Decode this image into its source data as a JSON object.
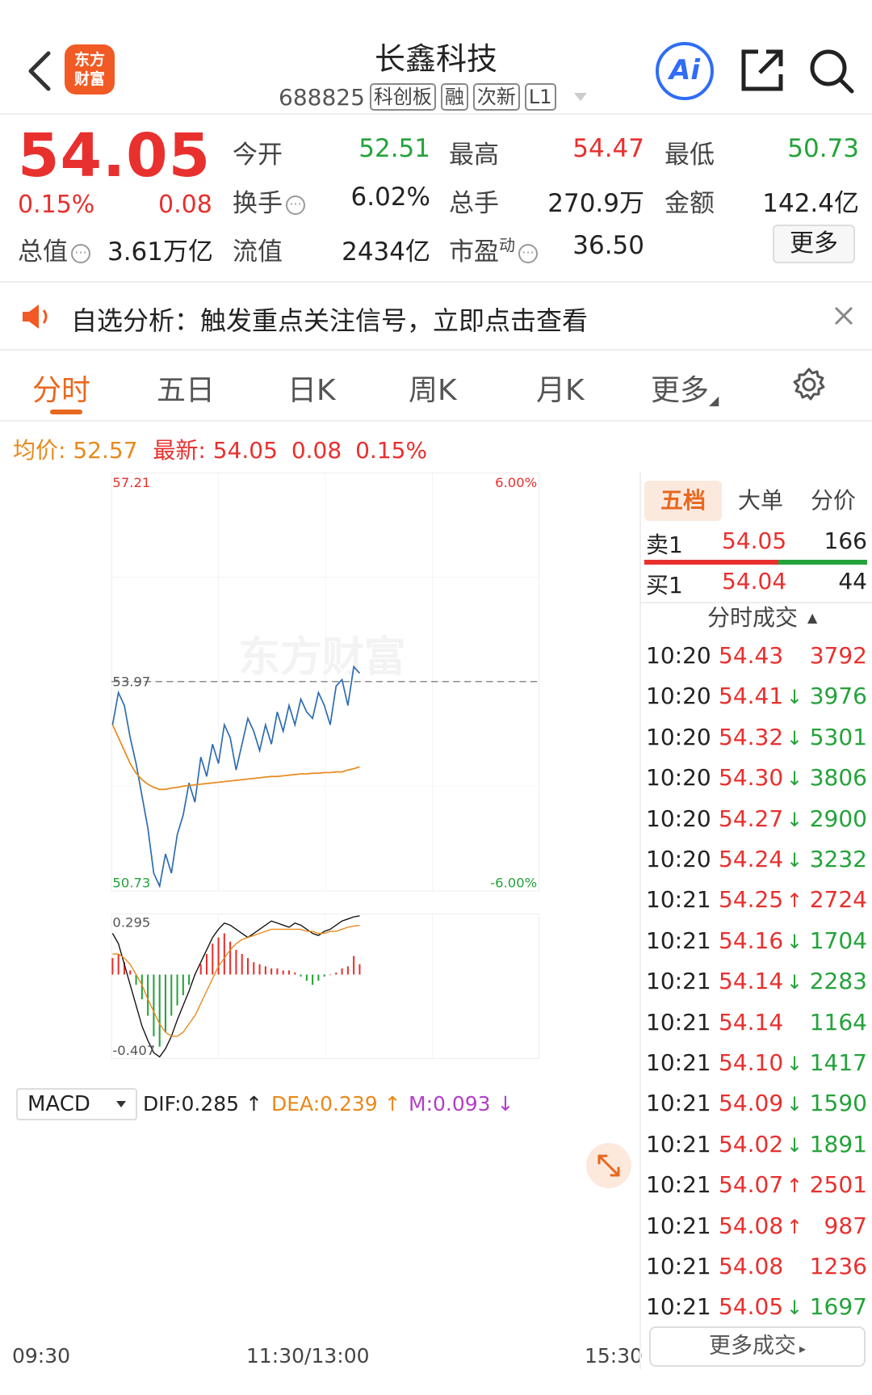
{
  "header": {
    "logo_text": "东方\n财富",
    "title": "长鑫科技",
    "code": "688825",
    "tags": [
      "科创板",
      "融",
      "次新",
      "L1"
    ],
    "ai_label": "Ai"
  },
  "quote": {
    "price": "54.05",
    "change_pct": "0.15%",
    "change": "0.08",
    "stats": [
      {
        "label": "今开",
        "value": "52.51",
        "color": "green"
      },
      {
        "label": "最高",
        "value": "54.47",
        "color": "red"
      },
      {
        "label": "最低",
        "value": "50.73",
        "color": "green"
      },
      {
        "label": "换手",
        "value": "6.02%",
        "color": "black"
      },
      {
        "label": "总手",
        "value": "270.9万",
        "color": "black"
      },
      {
        "label": "金额",
        "value": "142.4亿",
        "color": "black"
      },
      {
        "label": "总值",
        "value": "3.61万亿",
        "color": "black"
      },
      {
        "label": "流值",
        "value": "2434亿",
        "color": "black"
      },
      {
        "label": "市盈",
        "label_sup": "动",
        "value": "36.50",
        "color": "black"
      }
    ],
    "more_label": "更多"
  },
  "notice": {
    "text": "自选分析：触发重点关注信号，立即点击查看"
  },
  "tabs": [
    {
      "label": "分时",
      "active": true
    },
    {
      "label": "五日",
      "active": false
    },
    {
      "label": "日K",
      "active": false
    },
    {
      "label": "周K",
      "active": false
    },
    {
      "label": "月K",
      "active": false
    },
    {
      "label": "更多",
      "active": false
    }
  ],
  "avg_line": {
    "avg_label": "均价:",
    "avg_value": "52.57",
    "latest_label": "最新:",
    "latest_value": "54.05",
    "latest_change": "0.08",
    "latest_pct": "0.15%"
  },
  "chart_data": {
    "type": "line",
    "title": "",
    "y_top_label": "57.21",
    "y_bottom_label": "50.73",
    "y_mid_label": "53.97",
    "pct_top_label": "6.00%",
    "pct_bottom_label": "-6.00%",
    "ylim": [
      50.73,
      57.21
    ],
    "prev_close": 53.97,
    "x_labels": [
      "09:30",
      "11:30/13:00",
      "15:30"
    ],
    "minutes_total": 240,
    "price_series": [
      53.3,
      53.8,
      53.6,
      53.1,
      52.7,
      52.2,
      51.7,
      51.0,
      50.8,
      51.3,
      51.0,
      51.6,
      51.9,
      52.4,
      52.1,
      52.8,
      52.5,
      53.0,
      52.7,
      53.3,
      53.1,
      52.6,
      53.0,
      53.4,
      53.2,
      52.9,
      53.3,
      53.0,
      53.5,
      53.2,
      53.6,
      53.3,
      53.7,
      53.5,
      53.4,
      53.8,
      53.6,
      53.3,
      53.9,
      54.0,
      53.6,
      54.2,
      54.1
    ],
    "avg_series": [
      53.3,
      53.1,
      52.9,
      52.7,
      52.55,
      52.45,
      52.38,
      52.33,
      52.3,
      52.3,
      52.32,
      52.33,
      52.35,
      52.36,
      52.37,
      52.38,
      52.39,
      52.4,
      52.41,
      52.42,
      52.43,
      52.44,
      52.45,
      52.46,
      52.47,
      52.48,
      52.49,
      52.5,
      52.5,
      52.51,
      52.52,
      52.53,
      52.54,
      52.54,
      52.55,
      52.55,
      52.56,
      52.56,
      52.57,
      52.57,
      52.6,
      52.62,
      52.65
    ],
    "macd": {
      "name": "MACD",
      "dif_label": "DIF:0.285 ↑",
      "dea_label": "DEA:0.239 ↑",
      "m_label": "M:0.093 ↓",
      "y_top_label": "0.295",
      "y_bottom_label": "-0.407",
      "ylim": [
        -0.407,
        0.295
      ],
      "hist": [
        0.08,
        0.1,
        0.06,
        0.02,
        -0.05,
        -0.12,
        -0.2,
        -0.3,
        -0.35,
        -0.28,
        -0.2,
        -0.15,
        -0.1,
        -0.05,
        0.0,
        0.05,
        0.1,
        0.15,
        0.18,
        0.2,
        0.16,
        0.12,
        0.1,
        0.08,
        0.06,
        0.05,
        0.04,
        0.03,
        0.03,
        0.02,
        0.02,
        0.01,
        -0.01,
        -0.03,
        -0.05,
        -0.03,
        -0.01,
        0.0,
        0.01,
        0.03,
        0.04,
        0.09,
        0.05
      ],
      "dif": [
        0.2,
        0.15,
        0.05,
        -0.05,
        -0.15,
        -0.25,
        -0.32,
        -0.38,
        -0.4,
        -0.36,
        -0.3,
        -0.22,
        -0.15,
        -0.08,
        0.0,
        0.06,
        0.12,
        0.18,
        0.22,
        0.25,
        0.24,
        0.22,
        0.2,
        0.18,
        0.2,
        0.22,
        0.24,
        0.26,
        0.25,
        0.24,
        0.23,
        0.25,
        0.24,
        0.22,
        0.2,
        0.19,
        0.21,
        0.22,
        0.24,
        0.26,
        0.27,
        0.28,
        0.285
      ],
      "dea": [
        0.1,
        0.1,
        0.08,
        0.05,
        0.0,
        -0.05,
        -0.12,
        -0.18,
        -0.24,
        -0.28,
        -0.3,
        -0.3,
        -0.28,
        -0.24,
        -0.2,
        -0.14,
        -0.08,
        -0.02,
        0.04,
        0.08,
        0.12,
        0.15,
        0.17,
        0.18,
        0.19,
        0.2,
        0.21,
        0.22,
        0.22,
        0.22,
        0.22,
        0.22,
        0.22,
        0.21,
        0.21,
        0.2,
        0.2,
        0.21,
        0.21,
        0.22,
        0.23,
        0.235,
        0.239
      ]
    }
  },
  "side": {
    "tabs": [
      "五档",
      "大单",
      "分价"
    ],
    "sell1": {
      "label": "卖1",
      "price": "54.05",
      "vol": "166"
    },
    "buy1": {
      "label": "买1",
      "price": "54.04",
      "vol": "44"
    },
    "trade_header": "分时成交",
    "trades": [
      {
        "t": "10:20",
        "p": "54.43",
        "arrow": "",
        "v": "3792",
        "vc": "red"
      },
      {
        "t": "10:20",
        "p": "54.41",
        "arrow": "↓",
        "v": "3976",
        "vc": "green"
      },
      {
        "t": "10:20",
        "p": "54.32",
        "arrow": "↓",
        "v": "5301",
        "vc": "green"
      },
      {
        "t": "10:20",
        "p": "54.30",
        "arrow": "↓",
        "v": "3806",
        "vc": "green"
      },
      {
        "t": "10:20",
        "p": "54.27",
        "arrow": "↓",
        "v": "2900",
        "vc": "green"
      },
      {
        "t": "10:20",
        "p": "54.24",
        "arrow": "↓",
        "v": "3232",
        "vc": "green"
      },
      {
        "t": "10:21",
        "p": "54.25",
        "arrow": "↑",
        "v": "2724",
        "vc": "red"
      },
      {
        "t": "10:21",
        "p": "54.16",
        "arrow": "↓",
        "v": "1704",
        "vc": "green"
      },
      {
        "t": "10:21",
        "p": "54.14",
        "arrow": "↓",
        "v": "2283",
        "vc": "green"
      },
      {
        "t": "10:21",
        "p": "54.14",
        "arrow": "",
        "v": "1164",
        "vc": "green"
      },
      {
        "t": "10:21",
        "p": "54.10",
        "arrow": "↓",
        "v": "1417",
        "vc": "green"
      },
      {
        "t": "10:21",
        "p": "54.09",
        "arrow": "↓",
        "v": "1590",
        "vc": "green"
      },
      {
        "t": "10:21",
        "p": "54.02",
        "arrow": "↓",
        "v": "1891",
        "vc": "green"
      },
      {
        "t": "10:21",
        "p": "54.07",
        "arrow": "↑",
        "v": "2501",
        "vc": "red"
      },
      {
        "t": "10:21",
        "p": "54.08",
        "arrow": "↑",
        "v": "987",
        "vc": "red"
      },
      {
        "t": "10:21",
        "p": "54.08",
        "arrow": "",
        "v": "1236",
        "vc": "red"
      },
      {
        "t": "10:21",
        "p": "54.05",
        "arrow": "↓",
        "v": "1697",
        "vc": "green"
      }
    ],
    "more_trades": "更多成交"
  },
  "watermark": "东方财富",
  "colors": {
    "red": "#e8302e",
    "green": "#24a33a",
    "orange": "#e8891b",
    "blue": "#2f6db0",
    "purple": "#b23ec8"
  }
}
